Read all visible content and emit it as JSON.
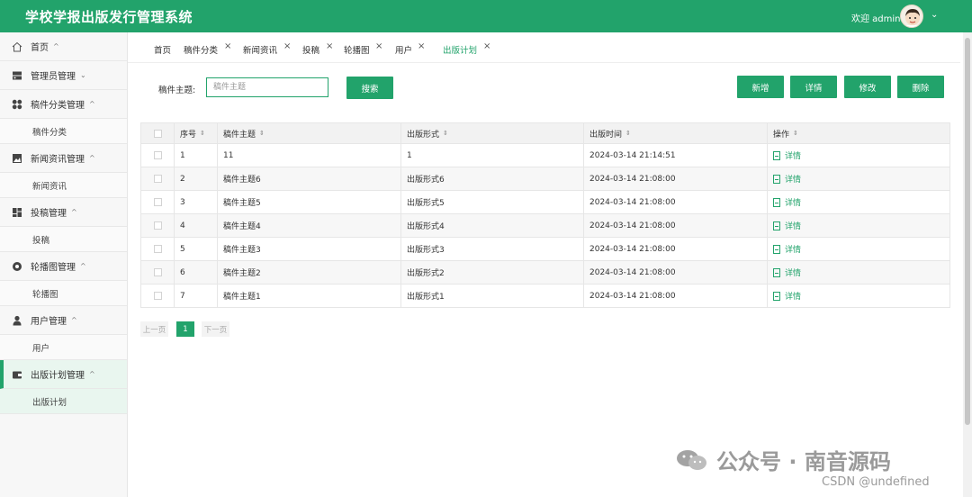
{
  "header": {
    "title": "学校学报出版发行管理系统",
    "welcome": "欢迎 admin",
    "chevron": "⌄"
  },
  "sidebar": {
    "items": [
      {
        "label": "首页",
        "icon": "home-icon",
        "caret": "^"
      },
      {
        "label": "管理员管理",
        "icon": "server-icon",
        "caret": "⌄"
      },
      {
        "label": "稿件分类管理",
        "icon": "grid-icon",
        "caret": "^",
        "sub": "稿件分类"
      },
      {
        "label": "新闻资讯管理",
        "icon": "image-icon",
        "caret": "^",
        "sub": "新闻资讯"
      },
      {
        "label": "投稿管理",
        "icon": "dashboard-icon",
        "caret": "^",
        "sub": "投稿"
      },
      {
        "label": "轮播图管理",
        "icon": "record-icon",
        "caret": "^",
        "sub": "轮播图"
      },
      {
        "label": "用户管理",
        "icon": "user-icon",
        "caret": "^",
        "sub": "用户"
      },
      {
        "label": "出版计划管理",
        "icon": "wallet-icon",
        "caret": "^",
        "sub": "出版计划"
      }
    ]
  },
  "tabs": [
    "首页",
    "稿件分类",
    "新闻资讯",
    "投稿",
    "轮播图",
    "用户",
    "出版计划"
  ],
  "tab_close": "×",
  "search": {
    "label": "稿件主题:",
    "placeholder": "稿件主题",
    "button": "搜索"
  },
  "actions": [
    "新增",
    "详情",
    "修改",
    "删除"
  ],
  "table": {
    "columns": [
      "序号",
      "稿件主题",
      "出版形式",
      "出版时间",
      "操作"
    ],
    "sort_icon": "⇕",
    "rows": [
      {
        "no": "1",
        "topic": "11",
        "form": "1",
        "time": "2024-03-14 21:14:51",
        "op": "详情"
      },
      {
        "no": "2",
        "topic": "稿件主题6",
        "form": "出版形式6",
        "time": "2024-03-14 21:08:00",
        "op": "详情"
      },
      {
        "no": "3",
        "topic": "稿件主题5",
        "form": "出版形式5",
        "time": "2024-03-14 21:08:00",
        "op": "详情"
      },
      {
        "no": "4",
        "topic": "稿件主题4",
        "form": "出版形式4",
        "time": "2024-03-14 21:08:00",
        "op": "详情"
      },
      {
        "no": "5",
        "topic": "稿件主题3",
        "form": "出版形式3",
        "time": "2024-03-14 21:08:00",
        "op": "详情"
      },
      {
        "no": "6",
        "topic": "稿件主题2",
        "form": "出版形式2",
        "time": "2024-03-14 21:08:00",
        "op": "详情"
      },
      {
        "no": "7",
        "topic": "稿件主题1",
        "form": "出版形式1",
        "time": "2024-03-14 21:08:00",
        "op": "详情"
      }
    ]
  },
  "pager": {
    "prev": "上一页",
    "current": "1",
    "next": "下一页"
  },
  "watermark": {
    "text": "公众号 · 南音源码",
    "csdn": "CSDN @undefined"
  },
  "colors": {
    "accent": "#22a36b"
  }
}
